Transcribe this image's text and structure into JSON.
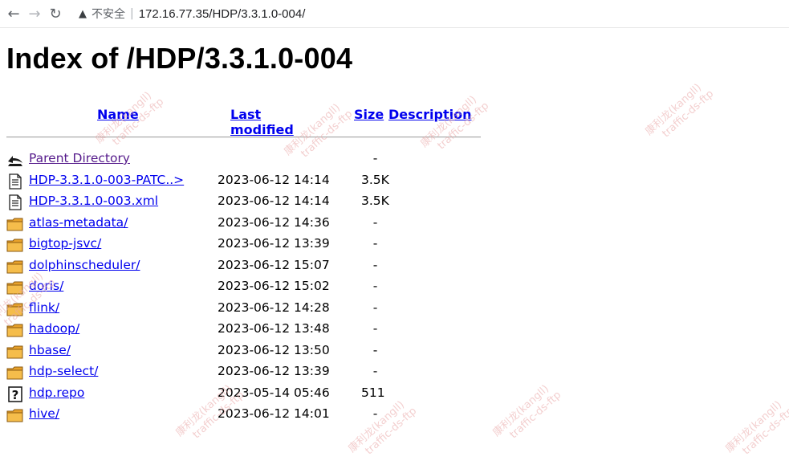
{
  "browser": {
    "back_icon": "back-arrow-icon",
    "forward_icon": "forward-arrow-icon",
    "reload_icon": "reload-icon",
    "security_label": "不安全",
    "separator": "|",
    "url": "172.16.77.35/HDP/3.3.1.0-004/"
  },
  "page": {
    "title": "Index of /HDP/3.3.1.0-004",
    "columns": {
      "name": "Name",
      "last_modified": "Last modified",
      "size": "Size",
      "description": "Description"
    },
    "rows": [
      {
        "icon": "parent",
        "name": "Parent Directory",
        "date": "",
        "size": "-"
      },
      {
        "icon": "text",
        "name": "HDP-3.3.1.0-003-PATC..>",
        "date": "2023-06-12 14:14",
        "size": "3.5K"
      },
      {
        "icon": "text",
        "name": "HDP-3.3.1.0-003.xml",
        "date": "2023-06-12 14:14",
        "size": "3.5K"
      },
      {
        "icon": "folder",
        "name": "atlas-metadata/",
        "date": "2023-06-12 14:36",
        "size": "-"
      },
      {
        "icon": "folder",
        "name": "bigtop-jsvc/",
        "date": "2023-06-12 13:39",
        "size": "-"
      },
      {
        "icon": "folder",
        "name": "dolphinscheduler/",
        "date": "2023-06-12 15:07",
        "size": "-"
      },
      {
        "icon": "folder",
        "name": "doris/",
        "date": "2023-06-12 15:02",
        "size": "-"
      },
      {
        "icon": "folder",
        "name": "flink/",
        "date": "2023-06-12 14:28",
        "size": "-"
      },
      {
        "icon": "folder",
        "name": "hadoop/",
        "date": "2023-06-12 13:48",
        "size": "-"
      },
      {
        "icon": "folder",
        "name": "hbase/",
        "date": "2023-06-12 13:50",
        "size": "-"
      },
      {
        "icon": "folder",
        "name": "hdp-select/",
        "date": "2023-06-12 13:39",
        "size": "-"
      },
      {
        "icon": "unknown",
        "name": "hdp.repo",
        "date": "2023-05-14 05:46",
        "size": "511"
      },
      {
        "icon": "folder",
        "name": "hive/",
        "date": "2023-06-12 14:01",
        "size": "-"
      }
    ]
  },
  "watermark": {
    "line1": "康利龙(kangll)",
    "line2": "traffic-ds-ftp"
  }
}
